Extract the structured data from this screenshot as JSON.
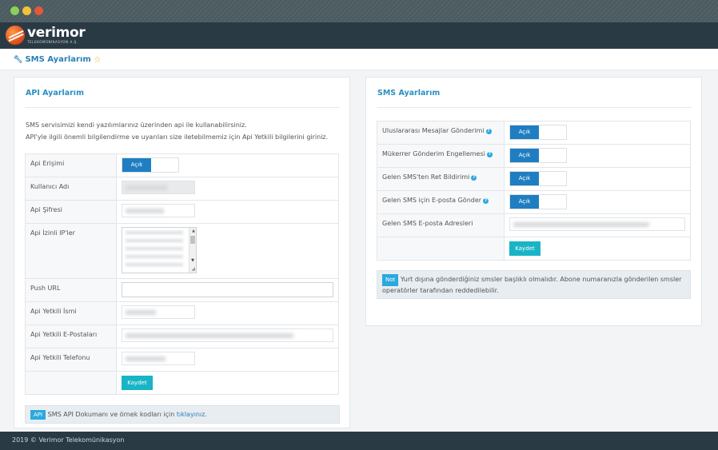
{
  "window": {
    "dots": [
      "green",
      "yellow",
      "red"
    ]
  },
  "brand": {
    "name": "verimor",
    "subtitle": "TELEKOMÜNİKASYON A.Ş.",
    "logo_color": "#e1511a"
  },
  "page": {
    "title": "SMS Ayarlarım",
    "title_icon": "wrench-icon",
    "favorite_icon": "star-outline-icon"
  },
  "api_panel": {
    "title": "API Ayarlarım",
    "intro_1": "SMS servisimizi kendi yazılımlarınız üzerinden api ile kullanabilirsiniz.",
    "intro_2": "API'yle ilgili önemli bilgilendirme ve uyarıları size iletebilmemiz için Api Yetkili bilgilerini giriniz.",
    "rows": {
      "access": "Api Erişimi",
      "username": "Kullanıcı Adı",
      "password": "Api Şifresi",
      "allowed_ips": "Api İzinli IP'ler",
      "push_url": "Push URL",
      "contact_name": "Api Yetkili İsmi",
      "contact_emails": "Api Yetkili E-Postaları",
      "contact_phone": "Api Yetkili Telefonu"
    },
    "toggle_on_label": "Açık",
    "save_label": "Kaydet",
    "note_tag": "API",
    "note_text": "SMS API Dokumanı ve örnek kodları için",
    "note_link": "tıklayınız."
  },
  "sms_panel": {
    "title": "SMS Ayarlarım",
    "rows": [
      {
        "label": "Uluslararası Mesajlar Gönderimi",
        "state": "Açık"
      },
      {
        "label": "Mükerrer Gönderim Engellemesi",
        "state": "Açık"
      },
      {
        "label": "Gelen SMS'ten Ret Bildirimi",
        "state": "Açık"
      },
      {
        "label": "Gelen SMS için E-posta Gönder",
        "state": "Açık"
      }
    ],
    "email_label": "Gelen SMS E-posta Adresleri",
    "save_label": "Kaydet",
    "note_tag": "Not",
    "note_text": "Yurt dışına gönderdiğiniz smsler başlıklı olmalıdır. Abone numaranızla gönderilen smsler operatörler tarafından reddedilebilir."
  },
  "footer": {
    "text": "2019 © Verimor Telekomünikasyon"
  },
  "colors": {
    "topbar": "#2a3a45",
    "accent": "#2a8fc0",
    "toggle_on": "#1f7ec1",
    "button": "#19b4c6",
    "tag": "#2aa9de"
  }
}
